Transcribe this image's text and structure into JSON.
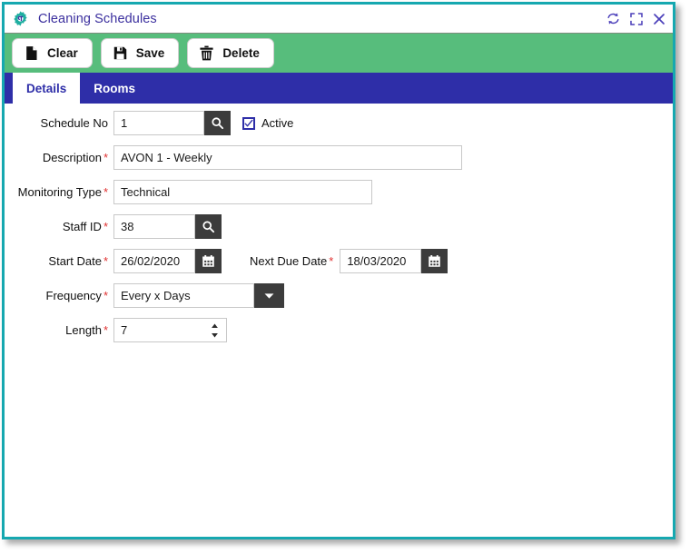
{
  "window": {
    "title": "Cleaning Schedules",
    "icon": "gear-icon",
    "controls": [
      {
        "name": "refresh-icon",
        "label": "Refresh"
      },
      {
        "name": "maximize-icon",
        "label": "Maximize"
      },
      {
        "name": "close-icon",
        "label": "Close"
      }
    ],
    "border_color": "#16a8b0"
  },
  "toolbar": {
    "background": "#57bd7c",
    "buttons": [
      {
        "label": "Clear",
        "icon": "document-icon"
      },
      {
        "label": "Save",
        "icon": "floppy-disk-icon"
      },
      {
        "label": "Delete",
        "icon": "trash-icon"
      }
    ]
  },
  "tabs": {
    "background": "#2e2ea8",
    "items": [
      {
        "label": "Details",
        "active": true
      },
      {
        "label": "Rooms",
        "active": false
      }
    ]
  },
  "form": {
    "schedule_no": {
      "label": "Schedule No",
      "required": false,
      "value": "1",
      "placeholder": "",
      "button_icon": "search-icon"
    },
    "active": {
      "label": "Active",
      "checked": true,
      "checkmark": "✔"
    },
    "description": {
      "label": "Description",
      "required": true,
      "value": "AVON 1 - Weekly",
      "placeholder": ""
    },
    "monitoring_type": {
      "label": "Monitoring Type",
      "required": true,
      "value": "Technical",
      "placeholder": ""
    },
    "staff_id": {
      "label": "Staff ID",
      "required": true,
      "value": "38",
      "placeholder": "",
      "button_icon": "search-icon"
    },
    "start_date": {
      "label": "Start Date",
      "required": true,
      "value": "26/02/2020",
      "placeholder": "",
      "button_icon": "calendar-icon"
    },
    "next_due_date": {
      "label": "Next Due Date",
      "required": true,
      "value": "18/03/2020",
      "placeholder": "",
      "button_icon": "calendar-icon"
    },
    "frequency": {
      "label": "Frequency",
      "required": true,
      "value": "Every x Days",
      "button_icon": "chevron-down-icon",
      "options": [
        "Every x Days"
      ]
    },
    "length": {
      "label": "Length",
      "required": true,
      "value": "7",
      "placeholder": "",
      "button_icon": "stepper-icon"
    },
    "required_marker": "*"
  }
}
